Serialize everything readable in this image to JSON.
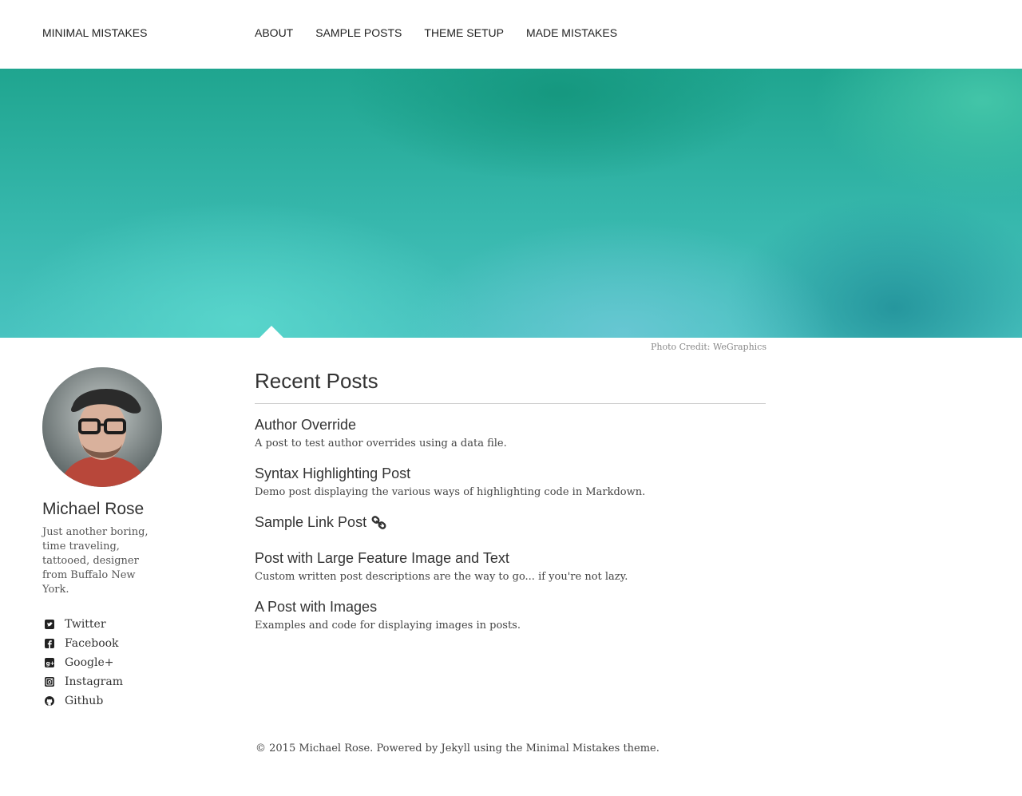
{
  "site": {
    "brand": "MINIMAL MISTAKES",
    "nav": [
      {
        "label": "ABOUT"
      },
      {
        "label": "SAMPLE POSTS"
      },
      {
        "label": "THEME SETUP"
      },
      {
        "label": "MADE MISTAKES"
      }
    ]
  },
  "hero": {
    "credit_prefix": "Photo Credit:",
    "credit_link": "WeGraphics"
  },
  "author": {
    "name": "Michael Rose",
    "bio": "Just another boring, time traveling, tattooed, designer from Buffalo New York.",
    "social": [
      {
        "label": "Twitter",
        "icon": "twitter-icon"
      },
      {
        "label": "Facebook",
        "icon": "facebook-icon"
      },
      {
        "label": "Google+",
        "icon": "google-plus-icon"
      },
      {
        "label": "Instagram",
        "icon": "instagram-icon"
      },
      {
        "label": "Github",
        "icon": "github-icon"
      }
    ]
  },
  "main": {
    "heading": "Recent Posts",
    "posts": [
      {
        "title": "Author Override",
        "excerpt": "A post to test author overrides using a data file."
      },
      {
        "title": "Syntax Highlighting Post",
        "excerpt": "Demo post displaying the various ways of highlighting code in Markdown."
      },
      {
        "title": "Sample Link Post",
        "excerpt": "",
        "icon": "link-icon"
      },
      {
        "title": "Post with Large Feature Image and Text",
        "excerpt": "Custom written post descriptions are the way to go... if you're not lazy."
      },
      {
        "title": "A Post with Images",
        "excerpt": "Examples and code for displaying images in posts."
      }
    ]
  },
  "footer": {
    "copyright": "© 2015 Michael Rose. Powered by",
    "jekyll": "Jekyll",
    "middle": "using the",
    "theme": "Minimal Mistakes",
    "suffix": "theme."
  }
}
